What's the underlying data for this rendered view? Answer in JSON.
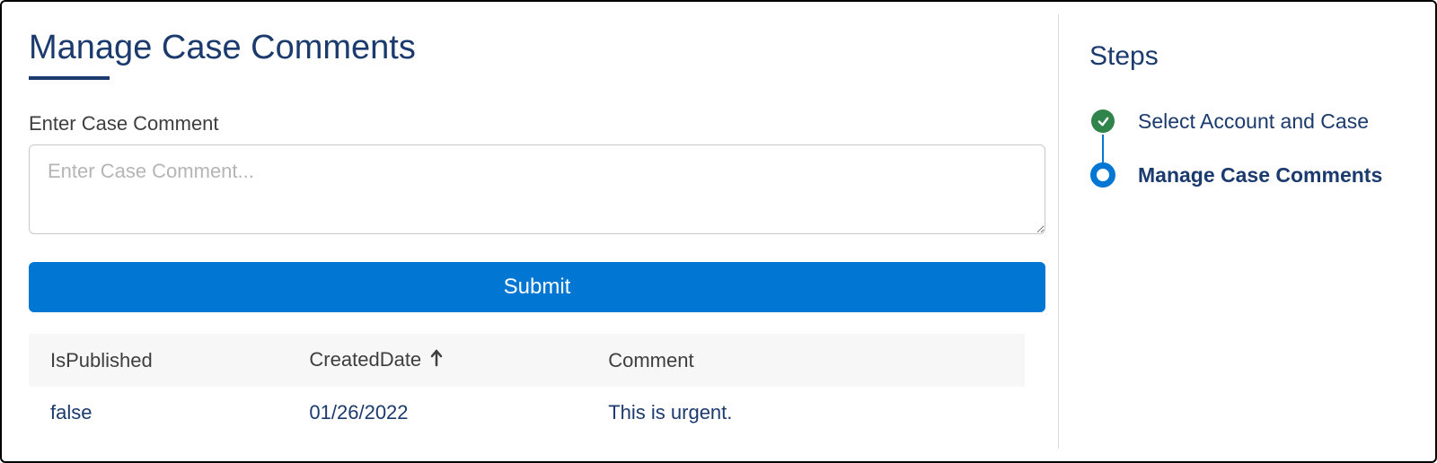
{
  "page": {
    "title": "Manage Case Comments"
  },
  "form": {
    "comment_label": "Enter Case Comment",
    "comment_placeholder": "Enter Case Comment...",
    "submit_label": "Submit"
  },
  "table": {
    "columns": {
      "is_published": "IsPublished",
      "created_date": "CreatedDate",
      "comment": "Comment"
    },
    "sort": {
      "column": "CreatedDate",
      "direction": "asc"
    },
    "rows": [
      {
        "is_published": "false",
        "created_date": "01/26/2022",
        "comment": "This is urgent."
      }
    ]
  },
  "steps": {
    "title": "Steps",
    "items": [
      {
        "label": "Select Account and Case",
        "state": "complete"
      },
      {
        "label": "Manage Case Comments",
        "state": "current"
      }
    ]
  }
}
